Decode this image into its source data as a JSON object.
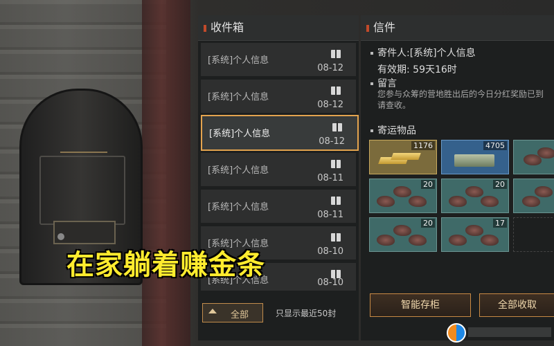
{
  "inbox": {
    "title": "收件箱",
    "items": [
      {
        "title": "[系统]个人信息",
        "date": "08-12"
      },
      {
        "title": "[系统]个人信息",
        "date": "08-12"
      },
      {
        "title": "[系统]个人信息",
        "date": "08-12"
      },
      {
        "title": "[系统]个人信息",
        "date": "08-11"
      },
      {
        "title": "[系统]个人信息",
        "date": "08-11"
      },
      {
        "title": "[系统]个人信息",
        "date": "08-10"
      },
      {
        "title": "[系统]个人信息",
        "date": "08-10"
      }
    ],
    "selected_index": 2,
    "filter_button": "全部",
    "limit_note": "只显示最近50封"
  },
  "letter": {
    "title": "信件",
    "sender": "寄件人:[系统]个人信息",
    "validity": "有效期: 59天16时",
    "message_heading": "留言",
    "message_lines": [
      "您参与众筹的营地胜出后的今日分红奖励已到",
      "请查收。"
    ],
    "attachments_heading": "寄运物品",
    "attachments": [
      {
        "icon": "gold-bar-icon",
        "qty": "1176"
      },
      {
        "icon": "cash-stack-icon",
        "qty": "4705"
      },
      {
        "icon": "ore-icon",
        "qty": ""
      },
      {
        "icon": "ore-icon",
        "qty": "20"
      },
      {
        "icon": "ore-icon",
        "qty": "20"
      },
      {
        "icon": "ore-icon",
        "qty": ""
      },
      {
        "icon": "ore-icon",
        "qty": "20"
      },
      {
        "icon": "ore-icon",
        "qty": "17"
      },
      {
        "icon": "empty-slot",
        "qty": ""
      }
    ],
    "smart_storage_button": "智能存柜",
    "claim_all_button": "全部收取"
  },
  "overlay_caption": "在家躺着赚金条",
  "colors": {
    "accent": "#e4a44e",
    "caption": "#ffec2e",
    "header_marker": "#c24a2a"
  }
}
